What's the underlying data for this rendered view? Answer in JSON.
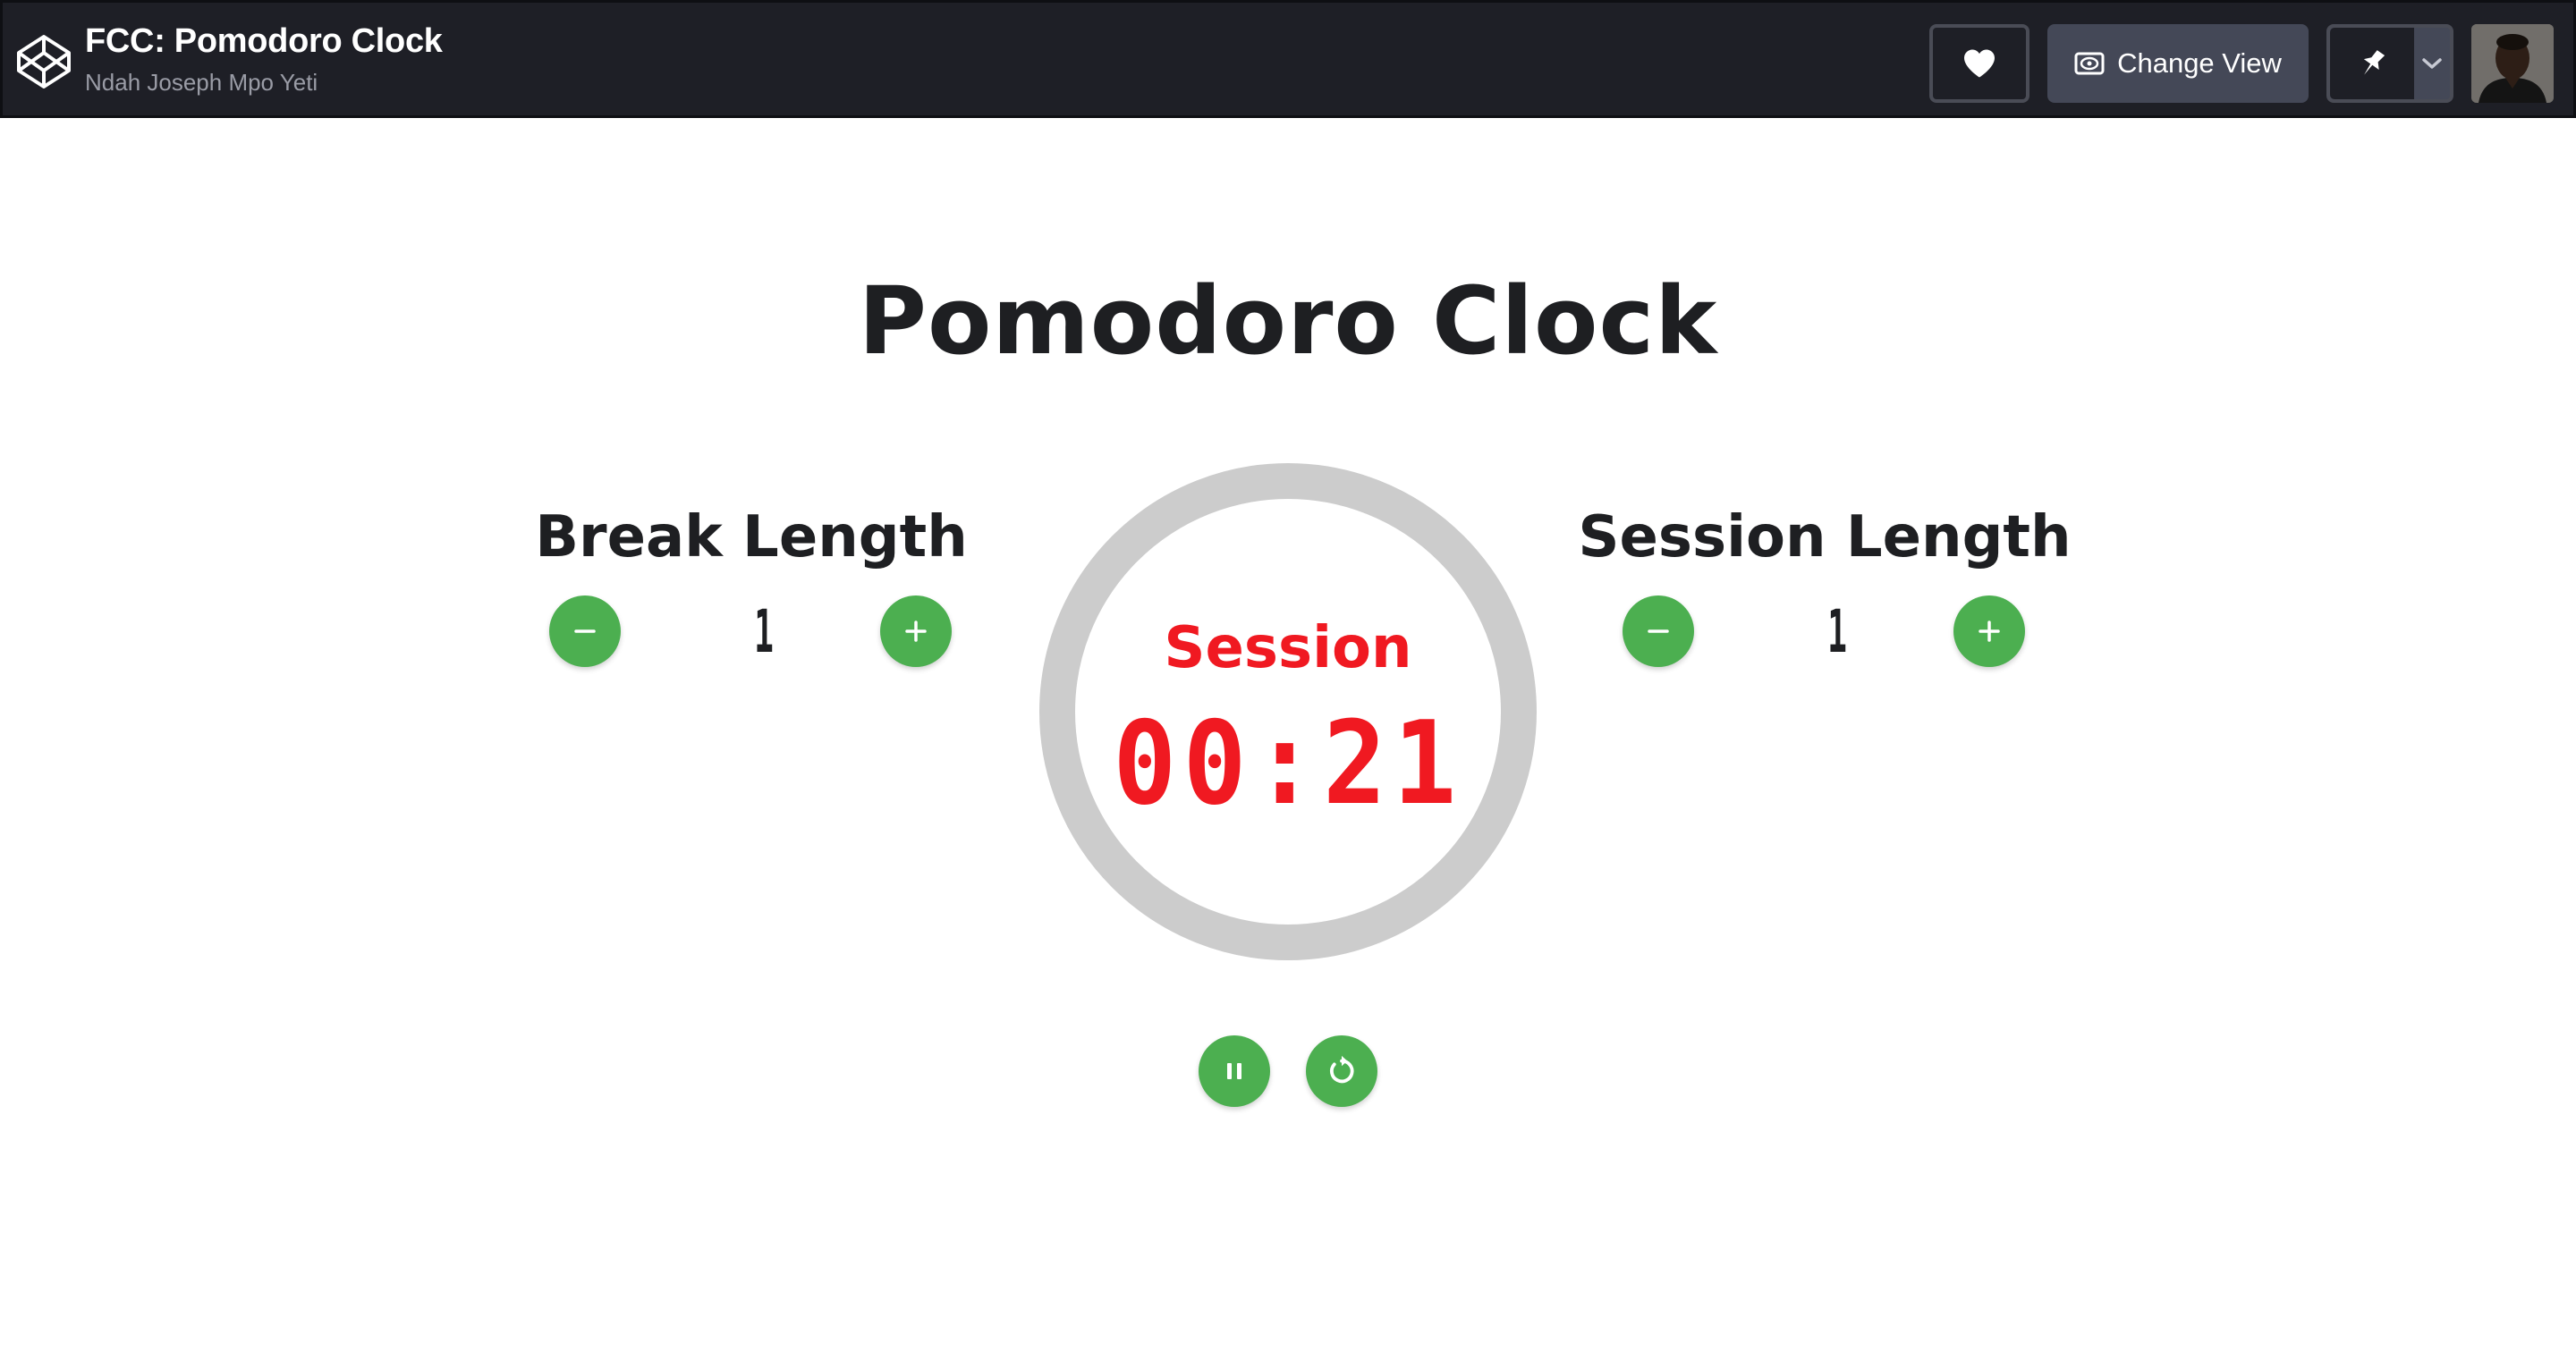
{
  "header": {
    "title": "FCC: Pomodoro Clock",
    "author": "Ndah Joseph Mpo Yeti",
    "change_view_label": "Change View",
    "icons": [
      "codepen-logo-icon",
      "heart-icon",
      "eye-icon",
      "pin-icon",
      "chevron-down-icon"
    ]
  },
  "main": {
    "heading": "Pomodoro Clock",
    "break": {
      "label": "Break Length",
      "value": "1"
    },
    "session": {
      "label": "Session Length",
      "value": "1"
    },
    "timer": {
      "label": "Session",
      "time": "00:21"
    },
    "controls": [
      "pause-icon",
      "reset-icon"
    ]
  },
  "colors": {
    "topbar": "#1e1f26",
    "accent_green": "#4caf50",
    "timer_red": "#f01921",
    "ring_gray": "#cccccc"
  }
}
